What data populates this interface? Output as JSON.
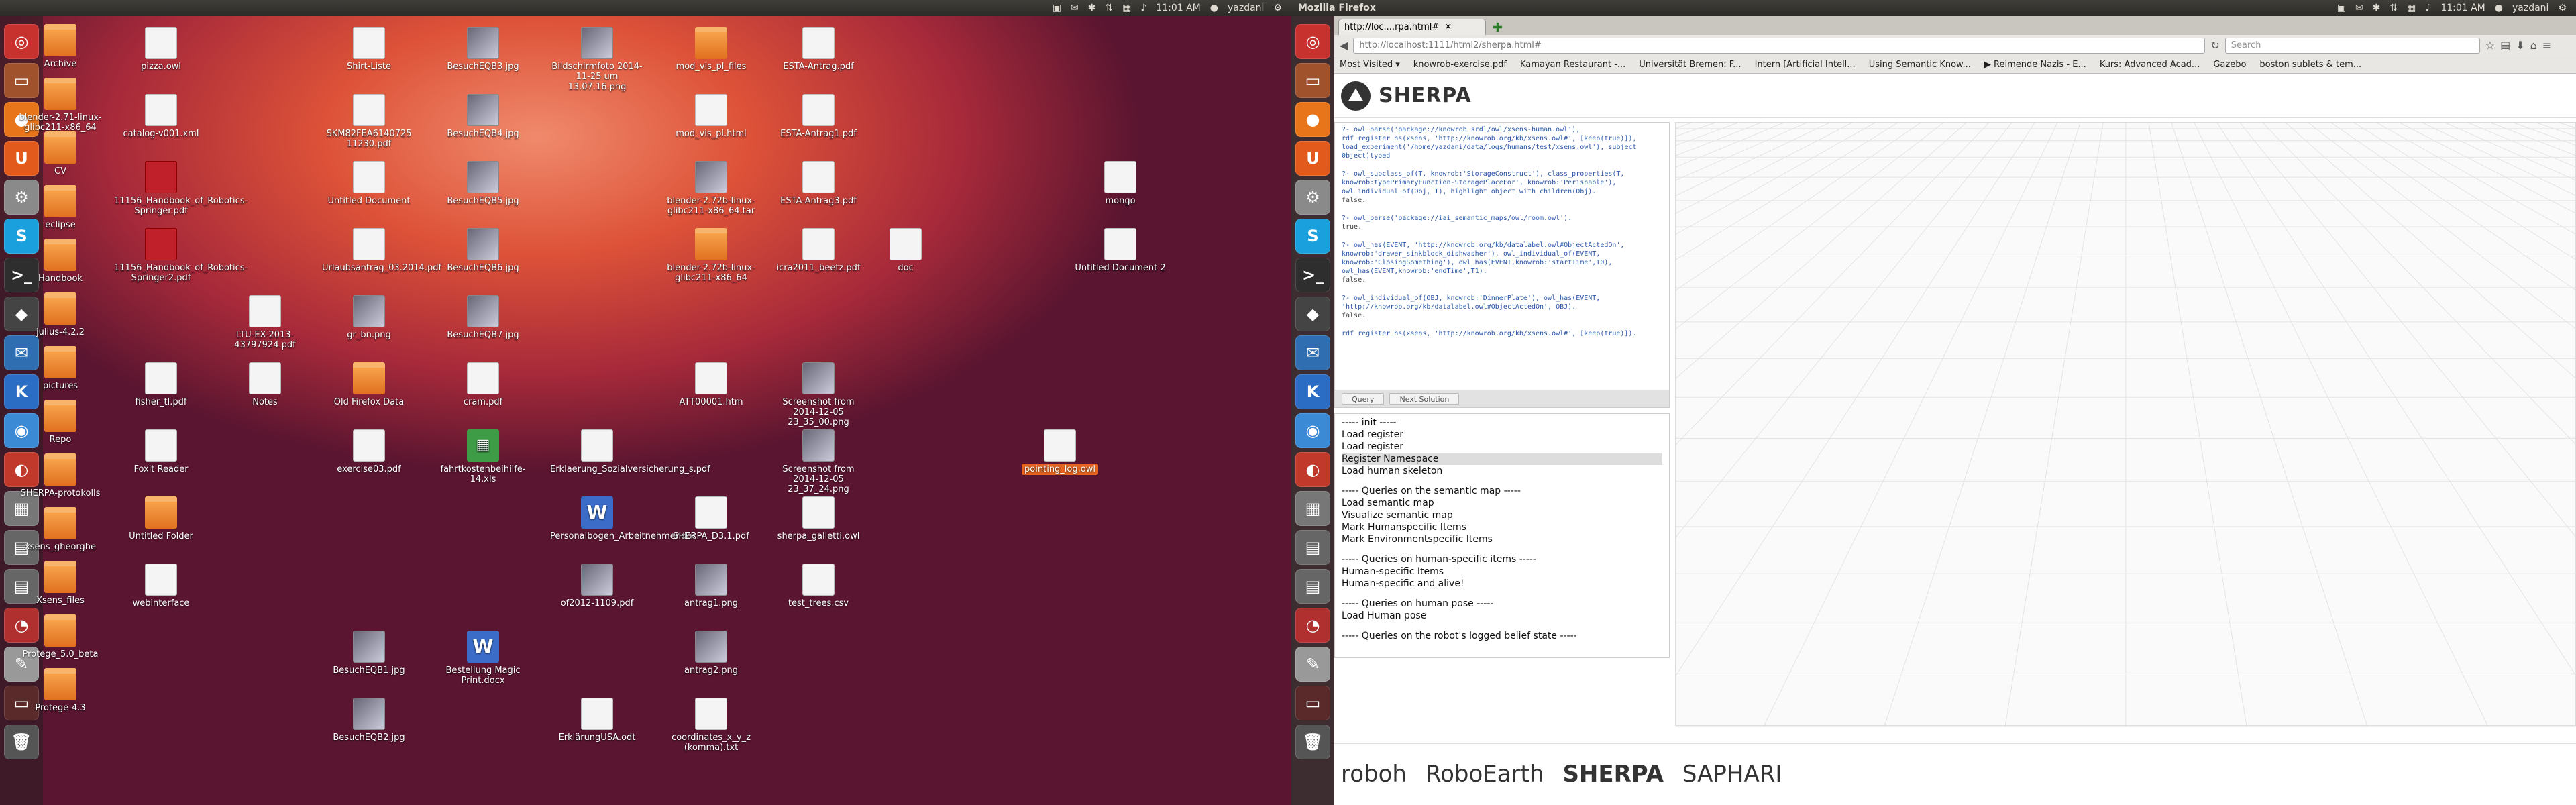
{
  "panel_left": {
    "title": "",
    "time": "11:01 AM",
    "user": "yazdani"
  },
  "panel_right": {
    "title": "Mozilla Firefox",
    "time": "11:01 AM",
    "user": "yazdani"
  },
  "desktop_icons": [
    {
      "label": "Archive",
      "type": "folder",
      "col": 0,
      "row": 0
    },
    {
      "label": "blender-2.71-linux-glibc211-x86_64",
      "type": "folder",
      "col": 0,
      "row": 1
    },
    {
      "label": "CV",
      "type": "folder",
      "col": 0,
      "row": 2
    },
    {
      "label": "eclipse",
      "type": "folder",
      "col": 0,
      "row": 3
    },
    {
      "label": "Handbook",
      "type": "folder",
      "col": 0,
      "row": 4
    },
    {
      "label": "julius-4.2.2",
      "type": "folder",
      "col": 0,
      "row": 5
    },
    {
      "label": "pictures",
      "type": "folder",
      "col": 0,
      "row": 6
    },
    {
      "label": "Repo",
      "type": "folder",
      "col": 0,
      "row": 7
    },
    {
      "label": "SHERPA-protokolls",
      "type": "folder",
      "col": 0,
      "row": 8
    },
    {
      "label": "xsens_gheorghe",
      "type": "folder",
      "col": 0,
      "row": 9
    },
    {
      "label": "Xsens_files",
      "type": "folder",
      "col": 0,
      "row": 10
    },
    {
      "label": "Protege_5.0_beta",
      "type": "folder",
      "col": 0,
      "row": 11
    },
    {
      "label": "Protege-4.3",
      "type": "folder",
      "col": 0,
      "row": 12
    },
    {
      "label": "pizza.owl",
      "type": "doc",
      "col": 1,
      "row": 0
    },
    {
      "label": "catalog-v001.xml",
      "type": "doc",
      "col": 1,
      "row": 1
    },
    {
      "label": "11156_Handbook_of_Robotics-Springer.pdf",
      "type": "pdfr",
      "col": 1,
      "row": 2
    },
    {
      "label": "11156_Handbook_of_Robotics-Springer2.pdf",
      "type": "pdfr",
      "col": 1,
      "row": 3
    },
    {
      "label": "fisher_tl.pdf",
      "type": "doc",
      "col": 1,
      "row": 5
    },
    {
      "label": "Foxit Reader",
      "type": "doc",
      "col": 1,
      "row": 6
    },
    {
      "label": "Untitled Folder",
      "type": "folder",
      "col": 1,
      "row": 7
    },
    {
      "label": "webinterface",
      "type": "doc",
      "col": 1,
      "row": 8
    },
    {
      "label": "LTU-EX-2013-43797924.pdf",
      "type": "doc",
      "col": 2,
      "row": 4
    },
    {
      "label": "Notes",
      "type": "doc",
      "col": 2,
      "row": 5
    },
    {
      "label": "Shirt-Liste",
      "type": "doc",
      "col": 3,
      "row": 0
    },
    {
      "label": "SKM82FEA6140725 11230.pdf",
      "type": "doc",
      "col": 3,
      "row": 1
    },
    {
      "label": "Untitled Document",
      "type": "doc",
      "col": 3,
      "row": 2
    },
    {
      "label": "Urlaubsantrag_03.2014.pdf",
      "type": "doc",
      "col": 3,
      "row": 3
    },
    {
      "label": "gr_bn.png",
      "type": "img",
      "col": 3,
      "row": 4
    },
    {
      "label": "Old Firefox Data",
      "type": "folder",
      "col": 3,
      "row": 5
    },
    {
      "label": "exercise03.pdf",
      "type": "doc",
      "col": 3,
      "row": 6
    },
    {
      "label": "BesuchEQB1.jpg",
      "type": "img",
      "col": 3,
      "row": 9
    },
    {
      "label": "BesuchEQB2.jpg",
      "type": "img",
      "col": 3,
      "row": 10
    },
    {
      "label": "BesuchEQB3.jpg",
      "type": "img",
      "col": 4,
      "row": 0
    },
    {
      "label": "BesuchEQB4.jpg",
      "type": "img",
      "col": 4,
      "row": 1
    },
    {
      "label": "BesuchEQB5.jpg",
      "type": "img",
      "col": 4,
      "row": 2
    },
    {
      "label": "BesuchEQB6.jpg",
      "type": "img",
      "col": 4,
      "row": 3
    },
    {
      "label": "BesuchEQB7.jpg",
      "type": "img",
      "col": 4,
      "row": 4
    },
    {
      "label": "cram.pdf",
      "type": "doc",
      "col": 4,
      "row": 5
    },
    {
      "label": "fahrtkostenbeihilfe-14.xls",
      "type": "excel",
      "col": 4,
      "row": 6
    },
    {
      "label": "Bestellung Magic Print.docx",
      "type": "word",
      "col": 4,
      "row": 9
    },
    {
      "label": "Bildschirmfoto 2014-11-25 um 13.07.16.png",
      "type": "img",
      "col": 5,
      "row": 0
    },
    {
      "label": "Erklaerung_Sozialversicherung_s.pdf",
      "type": "doc",
      "col": 5,
      "row": 6
    },
    {
      "label": "Personalbogen_Arbeitnehmer.doc",
      "type": "word",
      "col": 5,
      "row": 7
    },
    {
      "label": "of2012-1109.pdf",
      "type": "img",
      "col": 5,
      "row": 8
    },
    {
      "label": "ErklärungUSA.odt",
      "type": "doc",
      "col": 5,
      "row": 10
    },
    {
      "label": "mod_vis_pl_files",
      "type": "folder",
      "col": 6,
      "row": 0
    },
    {
      "label": "mod_vis_pl.html",
      "type": "doc",
      "col": 6,
      "row": 1
    },
    {
      "label": "blender-2.72b-linux-glibc211-x86_64.tar",
      "type": "img",
      "col": 6,
      "row": 2
    },
    {
      "label": "blender-2.72b-linux-glibc211-x86_64",
      "type": "folder",
      "col": 6,
      "row": 3
    },
    {
      "label": "ATT00001.htm",
      "type": "doc",
      "col": 6,
      "row": 5
    },
    {
      "label": "SHERPA_D3.1.pdf",
      "type": "doc",
      "col": 6,
      "row": 7
    },
    {
      "label": "antrag1.png",
      "type": "img",
      "col": 6,
      "row": 8
    },
    {
      "label": "antrag2.png",
      "type": "img",
      "col": 6,
      "row": 9
    },
    {
      "label": "coordinates_x_y_z (komma).txt",
      "type": "doc",
      "col": 6,
      "row": 10
    },
    {
      "label": "ESTA-Antrag.pdf",
      "type": "doc",
      "col": 7,
      "row": 0
    },
    {
      "label": "ESTA-Antrag1.pdf",
      "type": "doc",
      "col": 7,
      "row": 1
    },
    {
      "label": "ESTA-Antrag3.pdf",
      "type": "doc",
      "col": 7,
      "row": 2
    },
    {
      "label": "icra2011_beetz.pdf",
      "type": "doc",
      "col": 7,
      "row": 3
    },
    {
      "label": "Screenshot from 2014-12-05 23_35_00.png",
      "type": "img",
      "col": 7,
      "row": 5
    },
    {
      "label": "Screenshot from 2014-12-05 23_37_24.png",
      "type": "img",
      "col": 7,
      "row": 6
    },
    {
      "label": "sherpa_galletti.owl",
      "type": "doc",
      "col": 7,
      "row": 7
    },
    {
      "label": "test_trees.csv",
      "type": "doc",
      "col": 7,
      "row": 8
    },
    {
      "label": "doc",
      "type": "doc",
      "col": 8,
      "row": 3
    },
    {
      "label": "pointing_log.owl",
      "type": "doc",
      "col": 9,
      "row": 6,
      "selected": true
    },
    {
      "label": "mongo",
      "type": "doc",
      "col": 10,
      "row": 2
    },
    {
      "label": "Untitled Document 2",
      "type": "doc",
      "col": 10,
      "row": 3
    }
  ],
  "launcher": [
    {
      "name": "ubuntu-dash-icon",
      "glyph": "◎",
      "color": "#c7312e"
    },
    {
      "name": "files-icon",
      "glyph": "▭",
      "color": "#a0522d"
    },
    {
      "name": "firefox-icon",
      "glyph": "●",
      "color": "#e8751a"
    },
    {
      "name": "ubuntu-one-icon",
      "glyph": "U",
      "color": "#e35b1c"
    },
    {
      "name": "settings-icon",
      "glyph": "⚙",
      "color": "#8a8a8a"
    },
    {
      "name": "skype-icon",
      "glyph": "S",
      "color": "#1aa0dc"
    },
    {
      "name": "terminal-icon",
      "glyph": ">_",
      "color": "#2e2e2e"
    },
    {
      "name": "dark-app-icon",
      "glyph": "◆",
      "color": "#444"
    },
    {
      "name": "thunderbird-icon",
      "glyph": "✉",
      "color": "#2f6fb1"
    },
    {
      "name": "kde-icon",
      "glyph": "K",
      "color": "#2b6cc4"
    },
    {
      "name": "chromium-icon",
      "glyph": "◉",
      "color": "#3b8ad6"
    },
    {
      "name": "app-red-icon",
      "glyph": "◐",
      "color": "#c0392b"
    },
    {
      "name": "workspace-icon",
      "glyph": "▦",
      "color": "#777"
    },
    {
      "name": "disk-icon",
      "glyph": "▤",
      "color": "#666"
    },
    {
      "name": "disk2-icon",
      "glyph": "▤",
      "color": "#666"
    },
    {
      "name": "pdf-app-icon",
      "glyph": "◔",
      "color": "#b03030"
    },
    {
      "name": "editor-icon",
      "glyph": "✎",
      "color": "#999"
    },
    {
      "name": "display-icon",
      "glyph": "▭",
      "color": "#5a2a2a"
    },
    {
      "name": "trash-icon",
      "glyph": "🗑",
      "color": "#555"
    }
  ],
  "firefox": {
    "tab_label": "http://loc....rpa.html#",
    "url": "http://localhost:1111/html2/sherpa.html#",
    "search_placeholder": "Search",
    "bookmarks": [
      "Most Visited ▾",
      "knowrob-exercise.pdf",
      "Kamayan Restaurant -...",
      "Universität Bremen: F...",
      "Intern [Artificial Intell...",
      "Using Semantic Know...",
      "▶ Reimende Nazis - E...",
      "Kurs: Advanced Acad...",
      "Gazebo",
      "boston sublets & tem..."
    ]
  },
  "sherpa": {
    "title": "SHERPA",
    "editor_queries": [
      {
        "q": "?- owl_parse('package://knowrob_srdl/owl/xsens-human.owl'), rdf_register_ns(xsens, 'http://knowrob.org/kb/xsens.owl#', [keep(true)]), load_experiment('/home/yazdani/data/logs/humans/test/xsens.owl'), subject 0bject)typed",
        "r": ""
      },
      {
        "q": "?- owl_subclass_of(T, knowrob:'StorageConstruct'), class_properties(T, knowrob:typePrimaryFunction-StoragePlaceFor', knowrob:'Perishable'), owl_individual_of(Obj, T), highlight_object_with_children(Obj).",
        "r": "false."
      },
      {
        "q": "?- owl_parse('package://iai_semantic_maps/owl/room.owl').",
        "r": "true."
      },
      {
        "q": "?- owl_has(EVENT, 'http://knowrob.org/kb/datalabel.owl#ObjectActedOn', knowrob:'drawer_sinkblock_dishwasher'), owl_individual_of(EVENT, knowrob:'ClosingSomething'), owl_has(EVENT,knowrob:'startTime',T0), owl_has(EVENT,knowrob:'endTime',T1).",
        "r": "false."
      },
      {
        "q": "?- owl_individual_of(OBJ, knowrob:'DinnerPlate'), owl_has(EVENT, 'http://knowrob.org/kb/datalabel.owl#ObjectActedOn', OBJ).",
        "r": "false."
      },
      {
        "q": "rdf_register_ns(xsens, 'http://knowrob.org/kb/xsens.owl#', [keep(true)]).",
        "r": ""
      }
    ],
    "buttons": {
      "query": "Query",
      "next": "Next Solution"
    },
    "query_list": [
      {
        "t": "----- init -----"
      },
      {
        "t": "Load register"
      },
      {
        "t": "Load register"
      },
      {
        "t": "Register Namespace",
        "hl": true
      },
      {
        "t": "Load human skeleton"
      },
      {
        "t": ""
      },
      {
        "t": "----- Queries on the semantic map -----"
      },
      {
        "t": "Load semantic map"
      },
      {
        "t": "Visualize semantic map"
      },
      {
        "t": "Mark Humanspecific Items"
      },
      {
        "t": "Mark Environmentspecific Items"
      },
      {
        "t": ""
      },
      {
        "t": "----- Queries on human-specific items -----"
      },
      {
        "t": "Human-specific Items"
      },
      {
        "t": "Human-specific and alive!"
      },
      {
        "t": ""
      },
      {
        "t": "----- Queries on human pose -----"
      },
      {
        "t": "Load Human pose"
      },
      {
        "t": ""
      },
      {
        "t": "----- Queries on the robot's logged belief state -----"
      }
    ],
    "footer_logos": [
      "roboh",
      "RoboEarth",
      "SHERPA",
      "SAPHARI"
    ]
  }
}
